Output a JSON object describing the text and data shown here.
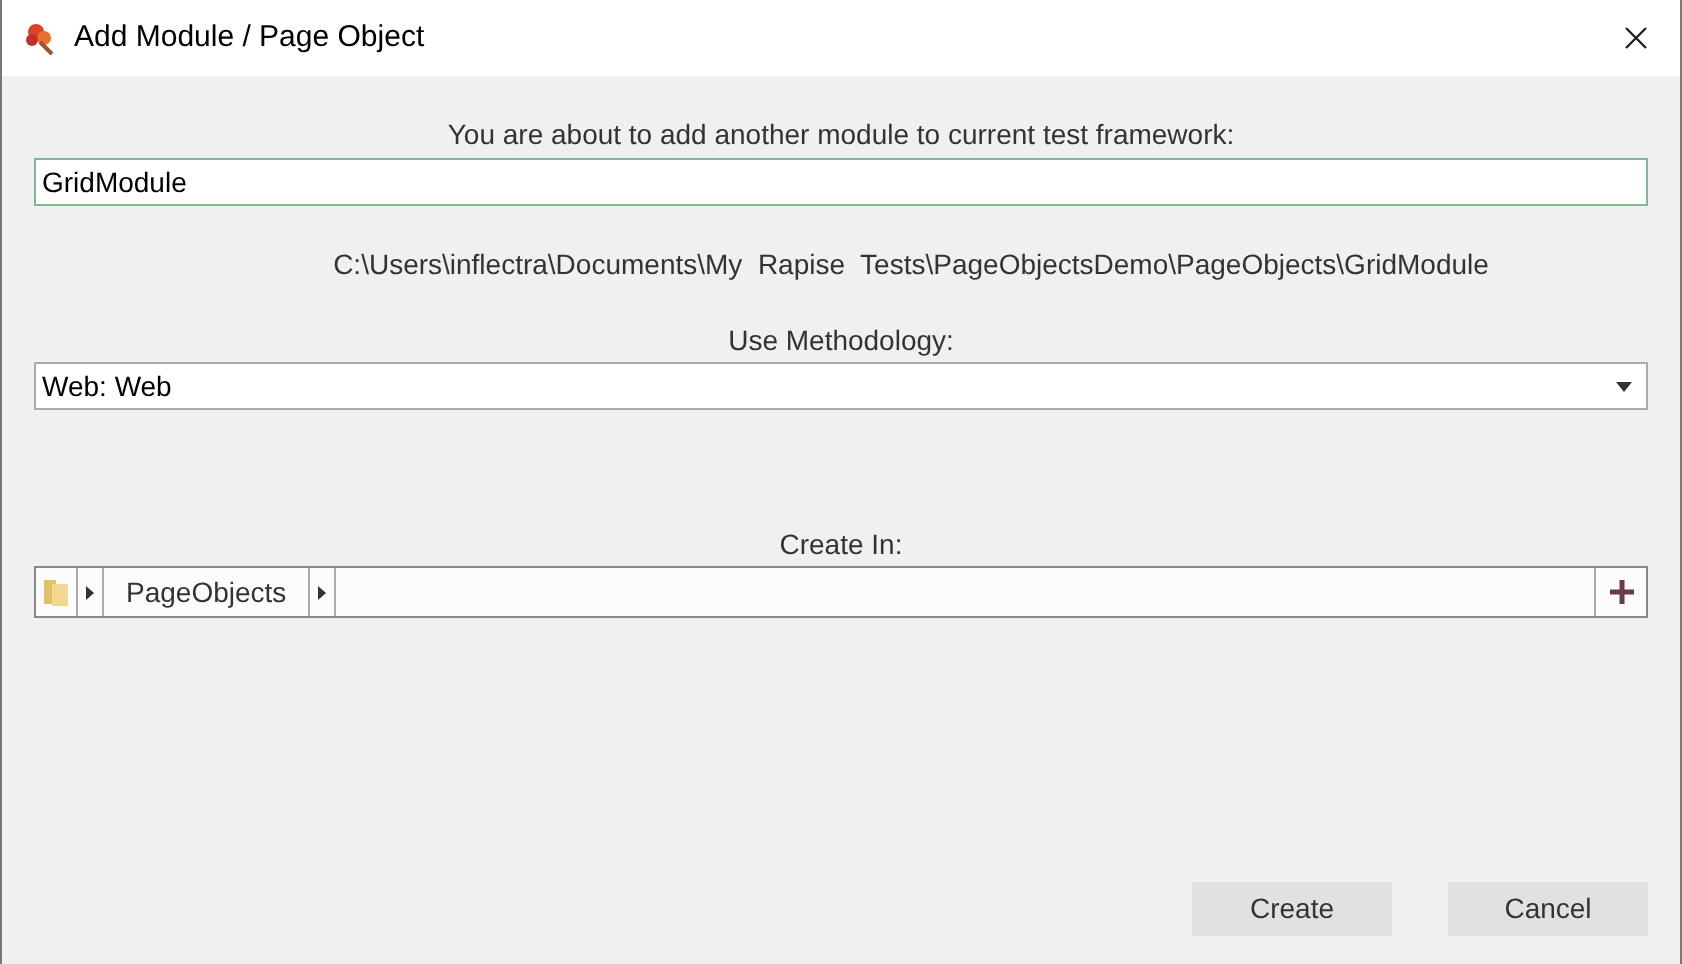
{
  "window": {
    "title": "Add Module / Page Object"
  },
  "name_prompt": "You are about to add another module to current test framework:",
  "name_field": {
    "value": "GridModule"
  },
  "path": "C:\\Users\\inflectra\\Documents\\My  Rapise  Tests\\PageObjectsDemo\\PageObjects\\GridModule",
  "methodology": {
    "label": "Use Methodology:",
    "value": "Web: Web"
  },
  "create_in": {
    "label": "Create In:",
    "crumbs": [
      "PageObjects"
    ]
  },
  "buttons": [
    "Create",
    "Cancel"
  ]
}
